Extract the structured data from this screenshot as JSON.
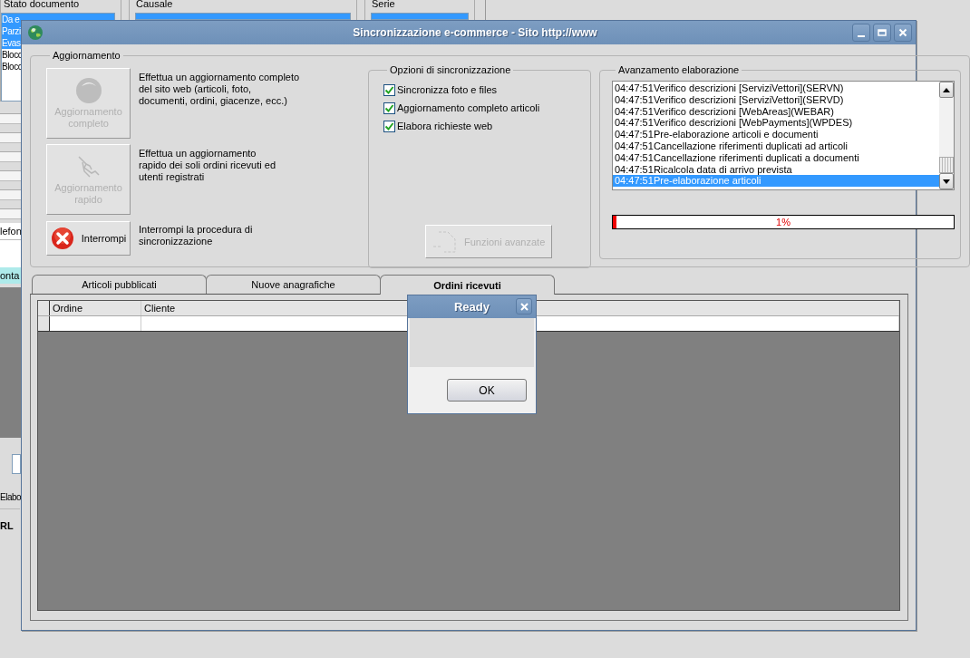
{
  "background_window": {
    "groups": [
      {
        "label": "Stato documento",
        "items": [
          {
            "text": "Da e",
            "selected": true
          },
          {
            "text": "Parzi",
            "selected": true
          },
          {
            "text": "Evas",
            "selected": true
          },
          {
            "text": "Blocc",
            "selected": false
          },
          {
            "text": "Blocc",
            "selected": false
          }
        ]
      },
      {
        "label": "Causale"
      },
      {
        "label": "Serie"
      }
    ],
    "fragments": [
      {
        "kind": "row",
        "text": "lefon"
      },
      {
        "kind": "highlight",
        "text": "onta"
      },
      {
        "kind": "label",
        "text": "Elabo"
      },
      {
        "kind": "bold",
        "text": "RL"
      }
    ]
  },
  "window": {
    "title": "Sincronizzazione e-commerce - Sito http://www"
  },
  "aggiornamento": {
    "label": "Aggiornamento",
    "actions": [
      {
        "kind": "globe",
        "button": [
          "Aggiornamento",
          "completo"
        ],
        "disabled": true,
        "description": [
          "Effettua un aggiornamento completo",
          "del sito web (articoli, foto,",
          "documenti, ordini, giacenze, ecc.)"
        ]
      },
      {
        "kind": "hand",
        "button": [
          "Aggiornamento",
          "rapido"
        ],
        "disabled": true,
        "description": [
          "Effettua un aggiornamento",
          "rapido dei soli ordini ricevuti ed",
          "utenti registrati"
        ]
      },
      {
        "kind": "stop",
        "button": [
          "Interrompi"
        ],
        "disabled": false,
        "description": [
          "Interrompi la procedura di",
          "sincronizzazione"
        ]
      }
    ]
  },
  "options": {
    "label": "Opzioni di sincronizzazione",
    "checkboxes": [
      {
        "label": "Sincronizza foto e files",
        "checked": true
      },
      {
        "label": "Aggiornamento completo articoli",
        "checked": true
      },
      {
        "label": "Elabora richieste web",
        "checked": true
      }
    ],
    "advanced_button": {
      "label": "Funzioni avanzate",
      "disabled": true
    }
  },
  "progress": {
    "label": "Avanzamento elaborazione",
    "log": [
      {
        "time": "04:47:51",
        "text": "Verifico descrizioni [ServiziVettori](SERVN)",
        "selected": false
      },
      {
        "time": "04:47:51",
        "text": "Verifico descrizioni [ServiziVettori](SERVD)",
        "selected": false
      },
      {
        "time": "04:47:51",
        "text": "Verifico descrizioni [WebAreas](WEBAR)",
        "selected": false
      },
      {
        "time": "04:47:51",
        "text": "Verifico descrizioni [WebPayments](WPDES)",
        "selected": false
      },
      {
        "time": "04:47:51",
        "text": "Pre-elaborazione articoli e documenti",
        "selected": false
      },
      {
        "time": "04:47:51",
        "text": "Cancellazione riferimenti duplicati ad articoli",
        "selected": false
      },
      {
        "time": "04:47:51",
        "text": "Cancellazione riferimenti duplicati a documenti",
        "selected": false
      },
      {
        "time": "04:47:51",
        "text": "Ricalcola data di arrivo prevista",
        "selected": false
      },
      {
        "time": "04:47:51",
        "text": "Pre-elaborazione articoli",
        "selected": true
      }
    ],
    "level": 0.01,
    "reading": "1%"
  },
  "tabs": [
    {
      "label": "Articoli pubblicati",
      "selected": false
    },
    {
      "label": "Nuove anagrafiche",
      "selected": false
    },
    {
      "label": "Ordini ricevuti",
      "selected": true
    }
  ],
  "table": {
    "columns": [
      "Ordine",
      "Cliente"
    ]
  },
  "dialog": {
    "title": "Ready",
    "button": "OK"
  }
}
